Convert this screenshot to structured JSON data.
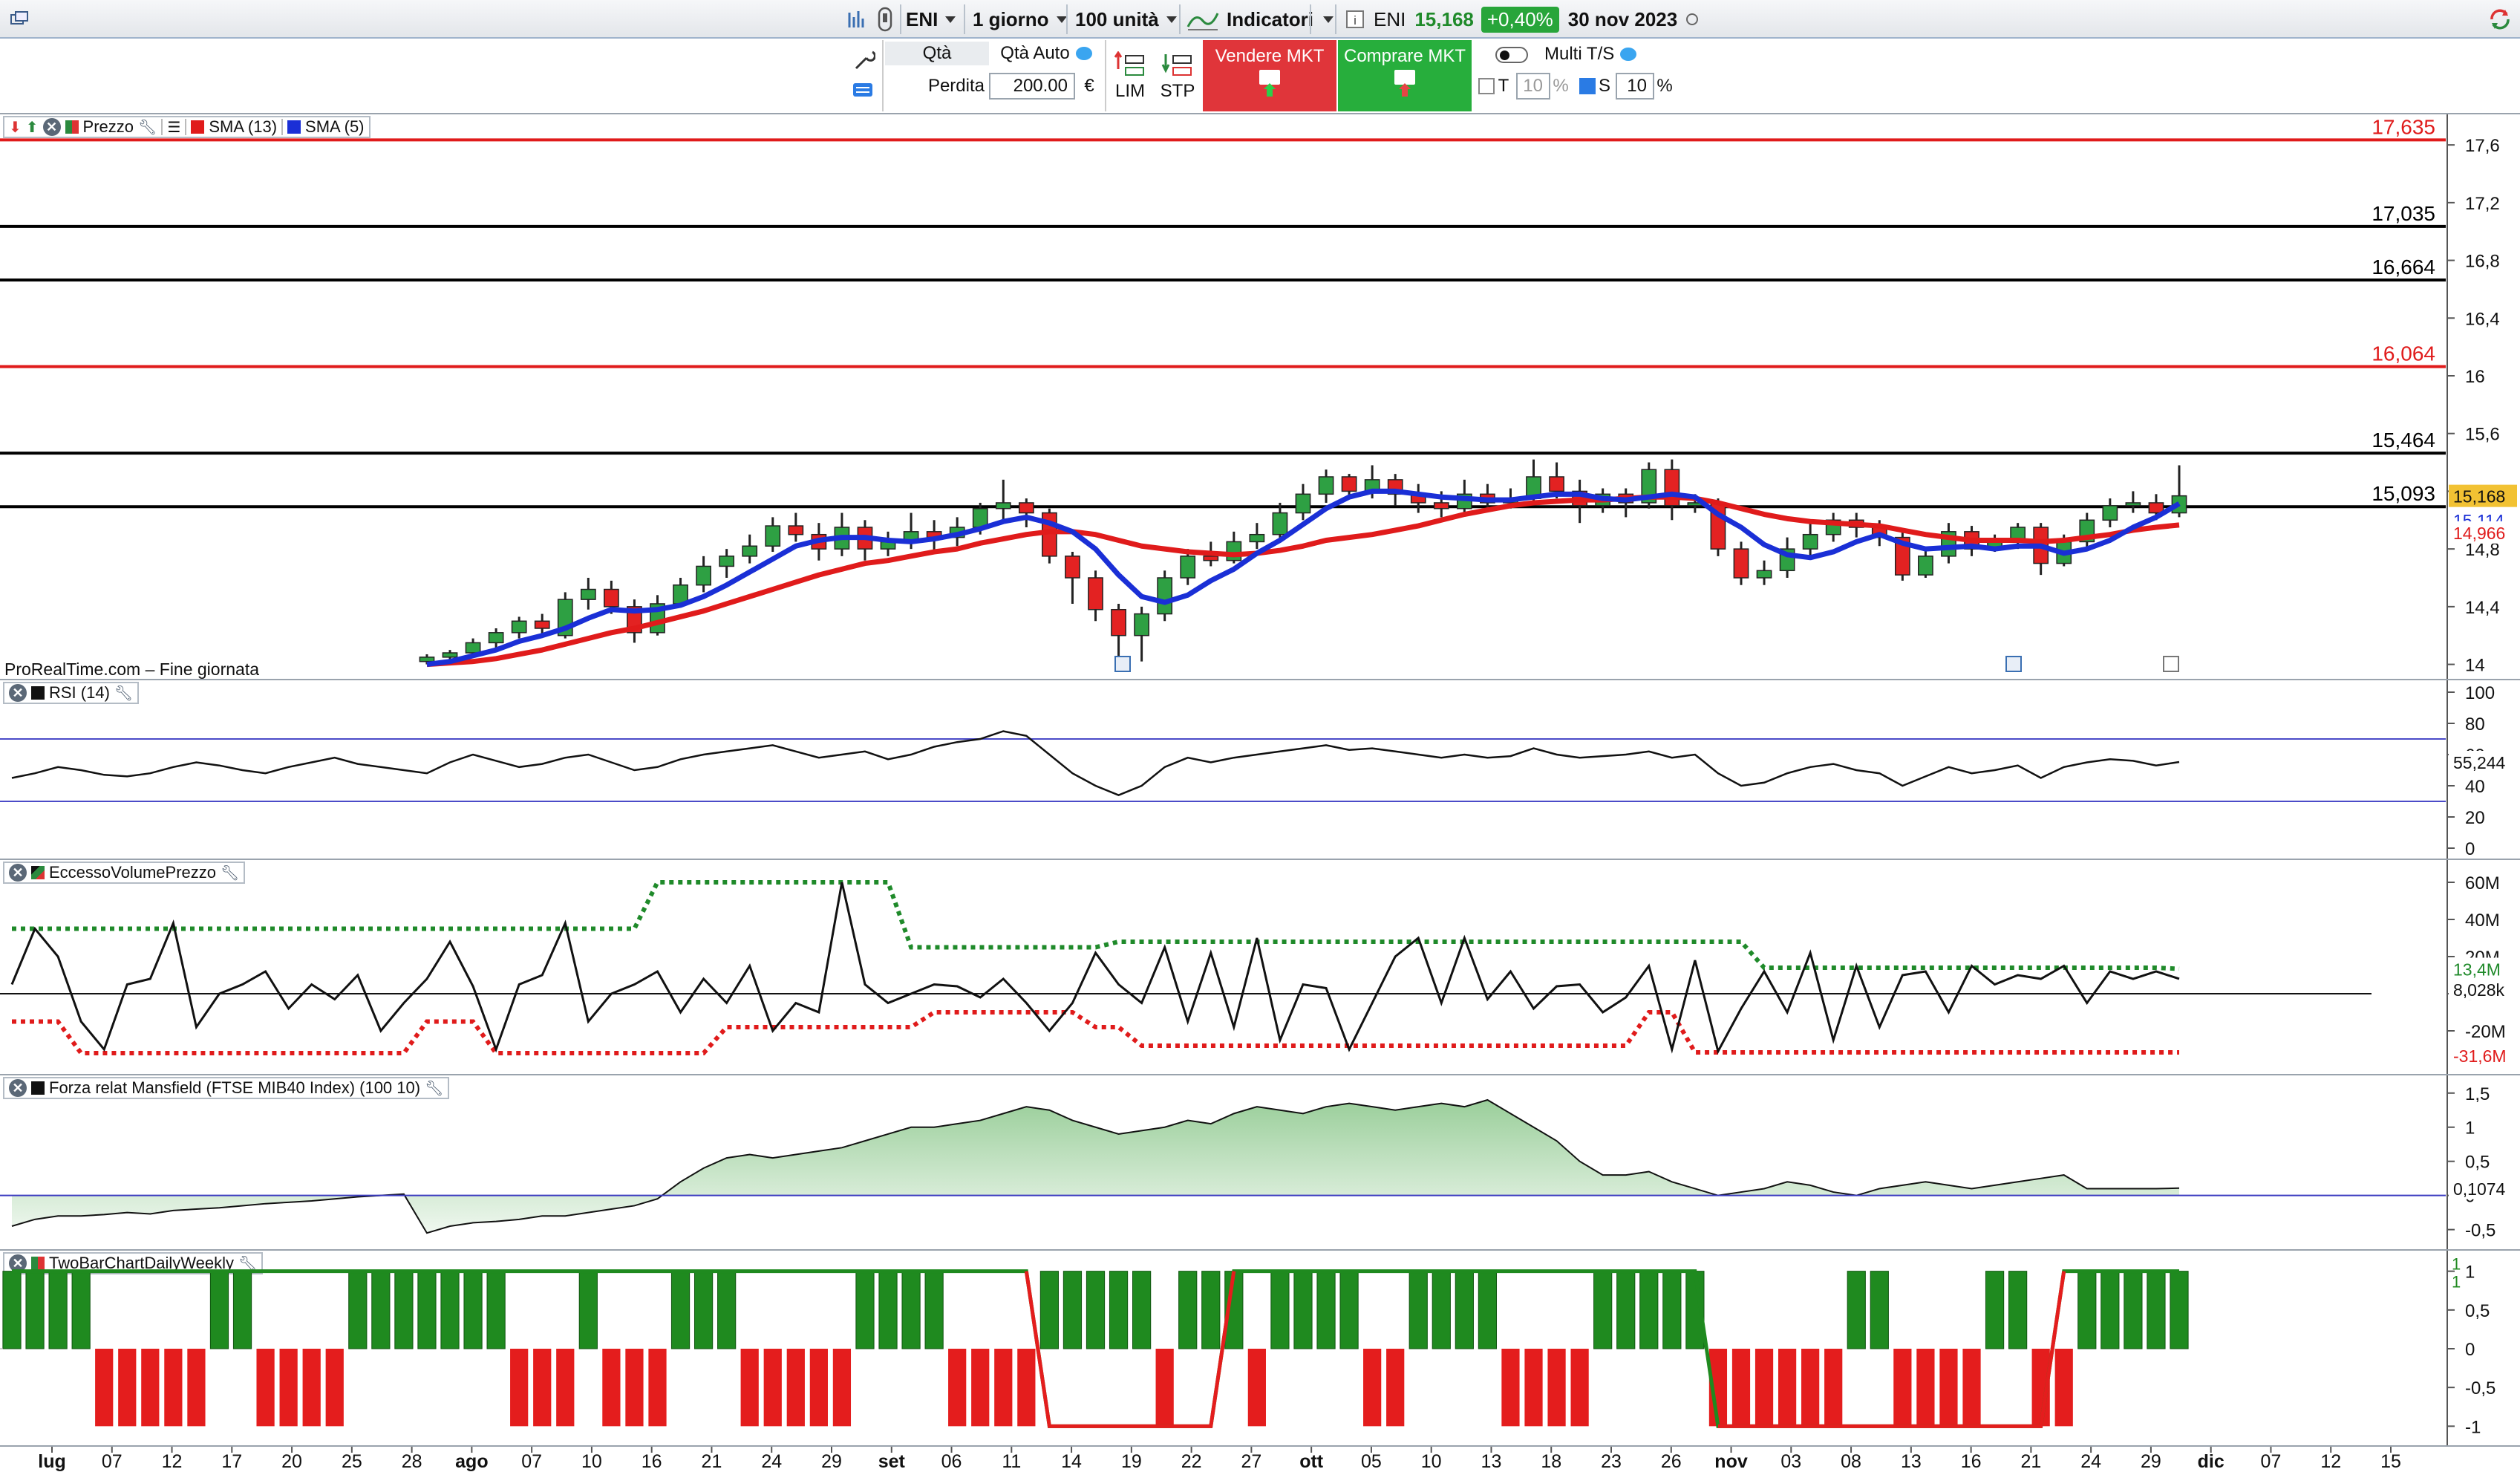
{
  "toolbar": {
    "symbol": "ENI",
    "timeframe": "1 giorno",
    "units": "100 unità",
    "indicators_label": "Indicatori",
    "ticker": "ENI",
    "last_price": "15,168",
    "change": "+0,40%",
    "date": "30 nov 2023",
    "colors": {
      "positive": "#28a53a"
    }
  },
  "order": {
    "qty_label": "Qtà",
    "qty_auto_label": "Qtà Auto",
    "loss_label": "Perdita",
    "loss_value": "200.00",
    "currency": "€",
    "lim_label": "LIM",
    "stp_label": "STP",
    "sell_label": "Vendere MKT",
    "buy_label": "Comprare MKT",
    "t_label": "T",
    "t_value": "10",
    "pct": "%",
    "multi_label": "Multi T/S",
    "s_label": "S",
    "s_value": "10",
    "colors": {
      "sell": "#e0353a",
      "buy": "#27ae3c"
    }
  },
  "price_panel": {
    "title": "Prezzo",
    "sma13_label": "SMA (13)",
    "sma5_label": "SMA (5)",
    "source_note": "ProRealTime.com – Fine giornata",
    "current_price": "15,168",
    "sma5_value": "15,114",
    "sma13_value": "14,966",
    "levels": [
      {
        "value": 17.635,
        "label": "17,635",
        "color": "#e01b1b"
      },
      {
        "value": 17.035,
        "label": "17,035",
        "color": "#000000"
      },
      {
        "value": 16.664,
        "label": "16,664",
        "color": "#000000"
      },
      {
        "value": 16.064,
        "label": "16,064",
        "color": "#e01b1b"
      },
      {
        "value": 15.464,
        "label": "15,464",
        "color": "#000000"
      },
      {
        "value": 15.093,
        "label": "15,093",
        "color": "#000000"
      }
    ],
    "y_ticks": [
      "17,6",
      "17,2",
      "16,8",
      "16,4",
      "16",
      "15,6",
      "15,2",
      "14,8",
      "14,4",
      "14"
    ],
    "colors": {
      "up": "#2ea043",
      "down": "#e32222",
      "sma13": "#e01b1b",
      "sma5": "#1a2fd6"
    }
  },
  "rsi_panel": {
    "title": "RSI (14)",
    "value": "55,244",
    "y_ticks": [
      "100",
      "80",
      "60",
      "40",
      "20",
      "0"
    ]
  },
  "evp_panel": {
    "title": "EccessoVolumePrezzo",
    "value": "8,028k",
    "upper_value": "13,4M",
    "lower_value": "-31,6M",
    "y_ticks": [
      "60M",
      "40M",
      "20M",
      "0",
      "-20M"
    ]
  },
  "mansfield_panel": {
    "title": "Forza relat Mansfield (FTSE MIB40 Index) (100 10)",
    "value": "0,1074",
    "y_ticks": [
      "1,5",
      "1",
      "0,5",
      "0",
      "-0,5"
    ]
  },
  "twobar_panel": {
    "title": "TwoBarChartDailyWeekly",
    "value_top": "1",
    "value_bottom": "1",
    "y_ticks": [
      "1",
      "0,5",
      "0",
      "-0,5",
      "-1"
    ]
  },
  "x_axis": {
    "labels": [
      {
        "t": "lug",
        "b": true
      },
      {
        "t": "07"
      },
      {
        "t": "12"
      },
      {
        "t": "17"
      },
      {
        "t": "20"
      },
      {
        "t": "25"
      },
      {
        "t": "28"
      },
      {
        "t": "ago",
        "b": true
      },
      {
        "t": "07"
      },
      {
        "t": "10"
      },
      {
        "t": "16"
      },
      {
        "t": "21"
      },
      {
        "t": "24"
      },
      {
        "t": "29"
      },
      {
        "t": "set",
        "b": true
      },
      {
        "t": "06"
      },
      {
        "t": "11"
      },
      {
        "t": "14"
      },
      {
        "t": "19"
      },
      {
        "t": "22"
      },
      {
        "t": "27"
      },
      {
        "t": "ott",
        "b": true
      },
      {
        "t": "05"
      },
      {
        "t": "10"
      },
      {
        "t": "13"
      },
      {
        "t": "18"
      },
      {
        "t": "23"
      },
      {
        "t": "26"
      },
      {
        "t": "nov",
        "b": true
      },
      {
        "t": "03"
      },
      {
        "t": "08"
      },
      {
        "t": "13"
      },
      {
        "t": "16"
      },
      {
        "t": "21"
      },
      {
        "t": "24"
      },
      {
        "t": "29"
      },
      {
        "t": "dic",
        "b": true
      },
      {
        "t": "07"
      },
      {
        "t": "12"
      },
      {
        "t": "15"
      }
    ]
  },
  "chart_data": {
    "type": "candlestick",
    "symbol": "ENI",
    "ylim": [
      14.0,
      17.7
    ],
    "candles": [
      [
        14.02,
        14.05,
        14.0,
        14.07
      ],
      [
        14.05,
        14.08,
        14.02,
        14.1
      ],
      [
        14.08,
        14.15,
        14.05,
        14.18
      ],
      [
        14.15,
        14.22,
        14.1,
        14.25
      ],
      [
        14.22,
        14.3,
        14.18,
        14.33
      ],
      [
        14.3,
        14.25,
        14.2,
        14.35
      ],
      [
        14.2,
        14.45,
        14.18,
        14.5
      ],
      [
        14.45,
        14.52,
        14.38,
        14.6
      ],
      [
        14.52,
        14.4,
        14.35,
        14.58
      ],
      [
        14.4,
        14.22,
        14.15,
        14.45
      ],
      [
        14.22,
        14.42,
        14.2,
        14.48
      ],
      [
        14.42,
        14.55,
        14.4,
        14.6
      ],
      [
        14.55,
        14.68,
        14.5,
        14.75
      ],
      [
        14.68,
        14.75,
        14.6,
        14.8
      ],
      [
        14.75,
        14.82,
        14.7,
        14.9
      ],
      [
        14.82,
        14.96,
        14.78,
        15.02
      ],
      [
        14.96,
        14.9,
        14.85,
        15.05
      ],
      [
        14.9,
        14.8,
        14.72,
        14.98
      ],
      [
        14.8,
        14.95,
        14.75,
        15.05
      ],
      [
        14.95,
        14.8,
        14.72,
        15.0
      ],
      [
        14.8,
        14.85,
        14.75,
        14.92
      ],
      [
        14.85,
        14.92,
        14.8,
        15.05
      ],
      [
        14.92,
        14.88,
        14.78,
        15.0
      ],
      [
        14.88,
        14.95,
        14.82,
        15.02
      ],
      [
        14.95,
        15.08,
        14.9,
        15.12
      ],
      [
        15.08,
        15.12,
        15.0,
        15.28
      ],
      [
        15.12,
        15.05,
        14.95,
        15.15
      ],
      [
        15.05,
        14.75,
        14.7,
        15.08
      ],
      [
        14.75,
        14.6,
        14.42,
        14.78
      ],
      [
        14.6,
        14.38,
        14.3,
        14.65
      ],
      [
        14.38,
        14.2,
        14.05,
        14.42
      ],
      [
        14.2,
        14.35,
        14.02,
        14.4
      ],
      [
        14.35,
        14.6,
        14.3,
        14.65
      ],
      [
        14.6,
        14.75,
        14.55,
        14.8
      ],
      [
        14.75,
        14.72,
        14.68,
        14.85
      ],
      [
        14.72,
        14.85,
        14.7,
        14.92
      ],
      [
        14.85,
        14.9,
        14.8,
        14.98
      ],
      [
        14.9,
        15.05,
        14.85,
        15.12
      ],
      [
        15.05,
        15.18,
        15.0,
        15.25
      ],
      [
        15.18,
        15.3,
        15.12,
        15.35
      ],
      [
        15.3,
        15.2,
        15.15,
        15.32
      ],
      [
        15.2,
        15.28,
        15.15,
        15.38
      ],
      [
        15.28,
        15.18,
        15.1,
        15.32
      ],
      [
        15.18,
        15.12,
        15.05,
        15.25
      ],
      [
        15.12,
        15.08,
        15.02,
        15.2
      ],
      [
        15.08,
        15.18,
        15.05,
        15.28
      ],
      [
        15.18,
        15.12,
        15.08,
        15.25
      ],
      [
        15.12,
        15.15,
        15.08,
        15.22
      ],
      [
        15.15,
        15.3,
        15.1,
        15.42
      ],
      [
        15.3,
        15.2,
        15.15,
        15.4
      ],
      [
        15.2,
        15.1,
        14.98,
        15.28
      ],
      [
        15.1,
        15.18,
        15.05,
        15.22
      ],
      [
        15.18,
        15.12,
        15.02,
        15.22
      ],
      [
        15.12,
        15.35,
        15.08,
        15.4
      ],
      [
        15.35,
        15.1,
        15.0,
        15.42
      ],
      [
        15.1,
        15.12,
        15.05,
        15.18
      ],
      [
        15.12,
        14.8,
        14.75,
        15.15
      ],
      [
        14.8,
        14.6,
        14.55,
        14.85
      ],
      [
        14.6,
        14.65,
        14.55,
        14.72
      ],
      [
        14.65,
        14.8,
        14.6,
        14.88
      ],
      [
        14.8,
        14.9,
        14.75,
        14.98
      ],
      [
        14.9,
        15.0,
        14.85,
        15.05
      ],
      [
        15.0,
        14.95,
        14.88,
        15.05
      ],
      [
        14.95,
        14.88,
        14.82,
        15.0
      ],
      [
        14.88,
        14.62,
        14.58,
        14.92
      ],
      [
        14.62,
        14.75,
        14.6,
        14.8
      ],
      [
        14.75,
        14.92,
        14.7,
        14.98
      ],
      [
        14.92,
        14.8,
        14.75,
        14.96
      ],
      [
        14.8,
        14.85,
        14.78,
        14.9
      ],
      [
        14.85,
        14.95,
        14.8,
        14.98
      ],
      [
        14.95,
        14.7,
        14.62,
        14.98
      ],
      [
        14.7,
        14.85,
        14.68,
        14.9
      ],
      [
        14.85,
        15.0,
        14.8,
        15.05
      ],
      [
        15.0,
        15.1,
        14.95,
        15.15
      ],
      [
        15.1,
        15.12,
        15.05,
        15.2
      ],
      [
        15.12,
        15.05,
        15.0,
        15.18
      ],
      [
        15.05,
        15.168,
        15.02,
        15.38
      ]
    ],
    "sma13": [
      14.0,
      14.01,
      14.02,
      14.04,
      14.07,
      14.1,
      14.14,
      14.18,
      14.22,
      14.25,
      14.29,
      14.33,
      14.37,
      14.42,
      14.47,
      14.52,
      14.57,
      14.62,
      14.66,
      14.7,
      14.72,
      14.75,
      14.78,
      14.8,
      14.84,
      14.87,
      14.9,
      14.92,
      14.92,
      14.9,
      14.86,
      14.82,
      14.8,
      14.78,
      14.77,
      14.76,
      14.77,
      14.79,
      14.82,
      14.86,
      14.88,
      14.9,
      14.93,
      14.96,
      15.0,
      15.04,
      15.07,
      15.1,
      15.12,
      15.13,
      15.14,
      15.14,
      15.15,
      15.16,
      15.16,
      15.15,
      15.12,
      15.08,
      15.04,
      15.01,
      14.99,
      14.98,
      14.97,
      14.96,
      14.93,
      14.9,
      14.88,
      14.86,
      14.86,
      14.86,
      14.85,
      14.86,
      14.88,
      14.9,
      14.93,
      14.95,
      14.966
    ],
    "sma5": [
      14.0,
      14.02,
      14.06,
      14.1,
      14.16,
      14.2,
      14.25,
      14.32,
      14.38,
      14.37,
      14.38,
      14.41,
      14.47,
      14.55,
      14.64,
      14.73,
      14.82,
      14.86,
      14.88,
      14.88,
      14.86,
      14.85,
      14.87,
      14.9,
      14.94,
      14.99,
      15.02,
      14.98,
      14.92,
      14.8,
      14.62,
      14.47,
      14.43,
      14.48,
      14.58,
      14.66,
      14.77,
      14.86,
      14.97,
      15.08,
      15.16,
      15.2,
      15.2,
      15.18,
      15.16,
      15.15,
      15.14,
      15.14,
      15.16,
      15.18,
      15.18,
      15.15,
      15.14,
      15.16,
      15.18,
      15.16,
      15.04,
      14.95,
      14.83,
      14.76,
      14.74,
      14.78,
      14.85,
      14.9,
      14.84,
      14.8,
      14.81,
      14.82,
      14.8,
      14.82,
      14.82,
      14.77,
      14.8,
      14.86,
      14.95,
      15.02,
      15.114
    ],
    "rsi": [
      48,
      55,
      60,
      56,
      52,
      54,
      58,
      60,
      55,
      50,
      52,
      57,
      60,
      62,
      64,
      66,
      62,
      58,
      60,
      62,
      57,
      60,
      65,
      68,
      70,
      75,
      72,
      60,
      48,
      40,
      34,
      40,
      52,
      58,
      55,
      58,
      60,
      62,
      64,
      66,
      63,
      64,
      62,
      60,
      58,
      60,
      58,
      59,
      64,
      60,
      58,
      59,
      60,
      62,
      58,
      60,
      48,
      40,
      42,
      48,
      52,
      54,
      50,
      48,
      40,
      46,
      52,
      48,
      50,
      53,
      45,
      52,
      55,
      57,
      56,
      53,
      55.244
    ],
    "evp": [
      8,
      28,
      4,
      -30,
      5,
      10,
      38,
      -15,
      0,
      5,
      12,
      -10,
      8,
      -5,
      15,
      -20,
      -5,
      -10,
      60,
      5,
      -5,
      0,
      5,
      4,
      -2,
      8,
      -5,
      -20,
      -5,
      22,
      5,
      -5,
      25,
      -15,
      22,
      -18,
      30,
      -25,
      5,
      3,
      -30,
      -5,
      20,
      30,
      -5,
      30,
      -3,
      12,
      -8,
      4,
      5,
      -10,
      -2,
      15,
      -30,
      18,
      -31,
      -8,
      12,
      -10,
      22,
      -25,
      15,
      -18,
      10,
      12,
      -10,
      15,
      5,
      10,
      8,
      15,
      -5,
      12,
      8,
      12,
      8.028
    ],
    "evp_upper": [
      35,
      35,
      35,
      35,
      35,
      35,
      35,
      35,
      35,
      35,
      60,
      60,
      60,
      60,
      60,
      60,
      60,
      60,
      60,
      60,
      60,
      25,
      25,
      25,
      25,
      25,
      25,
      25,
      25,
      25,
      28,
      28,
      28,
      28,
      28,
      28,
      28,
      28,
      28,
      28,
      28,
      28,
      28,
      28,
      28,
      28,
      28,
      28,
      28,
      28,
      28,
      28,
      28,
      28,
      28,
      28,
      28,
      28,
      14,
      14,
      14,
      14,
      14,
      14,
      14,
      14,
      14,
      14,
      14,
      14,
      14,
      14,
      14,
      14,
      14,
      14,
      13.4
    ],
    "evp_lower": [
      -15,
      -15,
      -15,
      -32,
      -32,
      -32,
      -32,
      -32,
      -32,
      -32,
      -32,
      -32,
      -32,
      -18,
      -18,
      -18,
      -18,
      -18,
      -18,
      -18,
      -18,
      -18,
      -10,
      -10,
      -10,
      -10,
      -10,
      -10,
      -10,
      -18,
      -18,
      -28,
      -28,
      -28,
      -28,
      -28,
      -28,
      -28,
      -28,
      -28,
      -28,
      -28,
      -28,
      -28,
      -28,
      -28,
      -28,
      -28,
      -28,
      -28,
      -28,
      -28,
      -28,
      -10,
      -10,
      -31.6,
      -31.6,
      -31.6,
      -31.6,
      -31.6,
      -31.6,
      -31.6,
      -31.6,
      -31.6,
      -31.6,
      -31.6,
      -31.6,
      -31.6,
      -31.6,
      -31.6,
      -31.6,
      -31.6,
      -31.6,
      -31.6,
      -31.6,
      -31.6,
      -31.6
    ],
    "mansfield": [
      -0.55,
      -0.45,
      -0.4,
      -0.38,
      -0.35,
      -0.3,
      -0.3,
      -0.25,
      -0.2,
      -0.15,
      -0.05,
      0.2,
      0.4,
      0.55,
      0.6,
      0.55,
      0.6,
      0.65,
      0.7,
      0.8,
      0.9,
      1.0,
      1.0,
      1.05,
      1.1,
      1.2,
      1.3,
      1.25,
      1.1,
      1.0,
      0.9,
      0.95,
      1.0,
      1.1,
      1.05,
      1.2,
      1.3,
      1.25,
      1.2,
      1.3,
      1.35,
      1.3,
      1.25,
      1.3,
      1.35,
      1.3,
      1.4,
      1.2,
      1.0,
      0.8,
      0.5,
      0.3,
      0.3,
      0.35,
      0.2,
      0.1,
      0.0,
      0.05,
      0.1,
      0.2,
      0.15,
      0.05,
      0.0,
      0.1,
      0.15,
      0.2,
      0.15,
      0.1,
      0.15,
      0.2,
      0.25,
      0.3,
      0.1,
      0.1,
      0.1,
      0.1,
      0.1074
    ],
    "twobar": [
      1,
      1,
      1,
      1,
      -1,
      -1,
      -1,
      1,
      -1,
      -1,
      -1,
      1,
      1,
      1,
      -1,
      -1,
      -1,
      -1,
      -1,
      1,
      1,
      1,
      1,
      -1,
      -1,
      -1,
      -1,
      1,
      1,
      1,
      1,
      1,
      -1,
      1,
      1,
      1,
      -1,
      1,
      1,
      1,
      1,
      -1,
      -1,
      1,
      1,
      1,
      1,
      -1,
      -1,
      -1,
      -1,
      1,
      1,
      1,
      1,
      1,
      -1,
      -1,
      -1,
      -1,
      -1,
      -1,
      1,
      1,
      -1,
      -1,
      -1,
      -1,
      1,
      1,
      -1,
      -1,
      1,
      1,
      1,
      1,
      1
    ]
  }
}
